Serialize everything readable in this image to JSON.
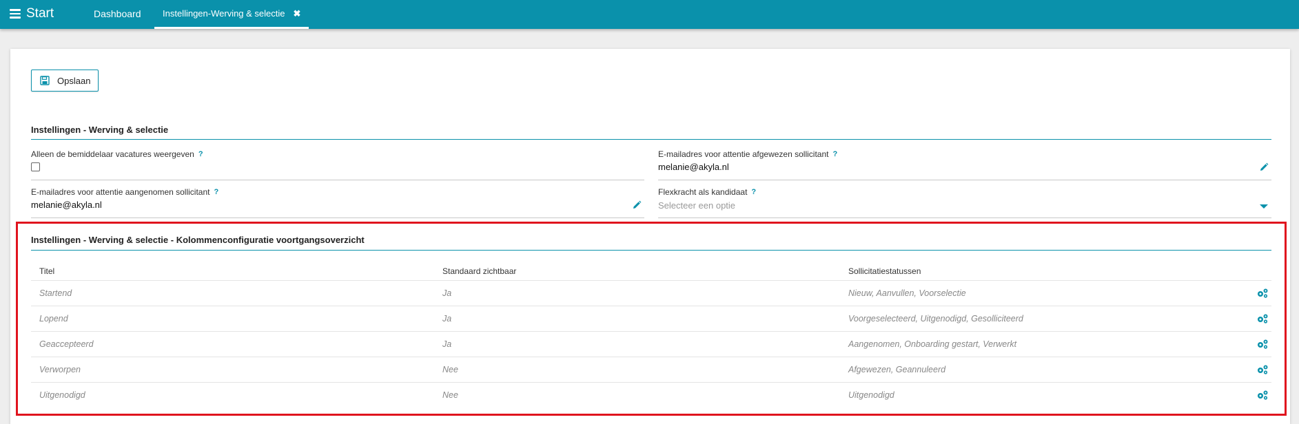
{
  "topbar": {
    "start_label": "Start",
    "tabs": [
      {
        "label": "Dashboard"
      },
      {
        "label": "Instellingen-Werving & selectie",
        "close": "✖"
      }
    ]
  },
  "toolbar": {
    "save_label": "Opslaan"
  },
  "settings": {
    "title": "Instellingen - Werving & selectie",
    "help_glyph": "?",
    "fields": {
      "only_mediator": {
        "label": "Alleen de bemiddelaar vacatures weergeven",
        "checked": false
      },
      "rejected_email": {
        "label": "E-mailadres voor attentie afgewezen sollicitant",
        "value": "melanie@akyla.nl"
      },
      "accepted_email": {
        "label": "E-mailadres voor attentie aangenomen sollicitant",
        "value": "melanie@akyla.nl"
      },
      "flex_candidate": {
        "label": "Flexkracht als kandidaat",
        "placeholder": "Selecteer een optie"
      }
    }
  },
  "columns_config": {
    "title": "Instellingen - Werving & selectie - Kolommenconfiguratie voortgangsoverzicht",
    "headers": [
      "Titel",
      "Standaard zichtbaar",
      "Sollicitatiestatussen"
    ],
    "rows": [
      {
        "title": "Startend",
        "visible": "Ja",
        "statuses": "Nieuw, Aanvullen, Voorselectie"
      },
      {
        "title": "Lopend",
        "visible": "Ja",
        "statuses": "Voorgeselecteerd, Uitgenodigd, Gesolliciteerd"
      },
      {
        "title": "Geaccepteerd",
        "visible": "Ja",
        "statuses": "Aangenomen, Onboarding gestart, Verwerkt"
      },
      {
        "title": "Verworpen",
        "visible": "Nee",
        "statuses": "Afgewezen, Geannuleerd"
      },
      {
        "title": "Uitgenodigd",
        "visible": "Nee",
        "statuses": "Uitgenodigd"
      }
    ]
  },
  "colors": {
    "accent": "#0a91ab",
    "highlight": "#e0141e"
  },
  "icons": [
    "menu-icon",
    "close-icon",
    "save-icon",
    "help-icon",
    "pencil-icon",
    "caret-down-icon",
    "cogs-icon"
  ]
}
